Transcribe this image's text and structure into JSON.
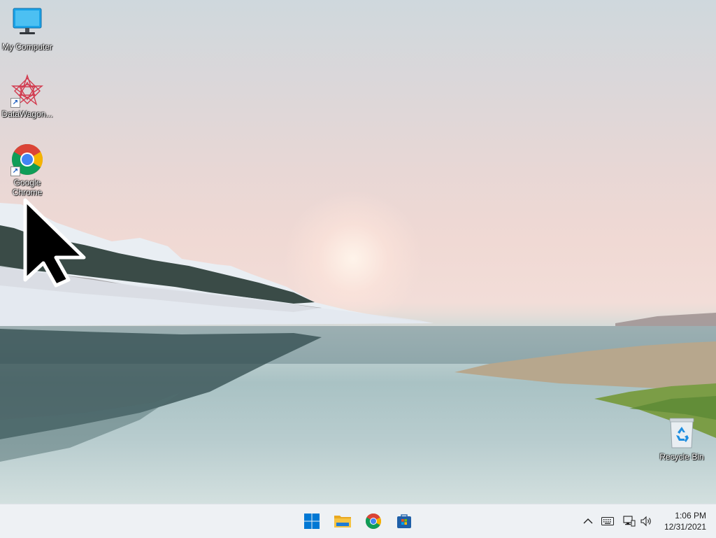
{
  "desktop": {
    "icons": [
      {
        "label": "My Computer",
        "icon": "computer-icon"
      },
      {
        "label": "DataWagon...",
        "icon": "datawagon-icon",
        "shortcut": true
      },
      {
        "label": "Google Chrome",
        "icon": "chrome-icon",
        "shortcut": true
      },
      {
        "label": "Recycle Bin",
        "icon": "recycle-bin-icon"
      }
    ]
  },
  "taskbar": {
    "pinned": [
      {
        "name": "Start",
        "icon": "windows-start-icon"
      },
      {
        "name": "File Explorer",
        "icon": "file-explorer-icon"
      },
      {
        "name": "Google Chrome",
        "icon": "chrome-icon"
      },
      {
        "name": "Microsoft Store",
        "icon": "store-icon"
      }
    ],
    "tray": {
      "icons": [
        "chevron-up-icon",
        "keyboard-icon",
        "network-icon",
        "volume-icon"
      ]
    },
    "clock": {
      "time": "1:06 PM",
      "date": "12/31/2021"
    }
  },
  "colors": {
    "taskbar_bg": "#eef1f4",
    "start_blue": "#0078d4",
    "folder_yellow": "#f5c342"
  }
}
